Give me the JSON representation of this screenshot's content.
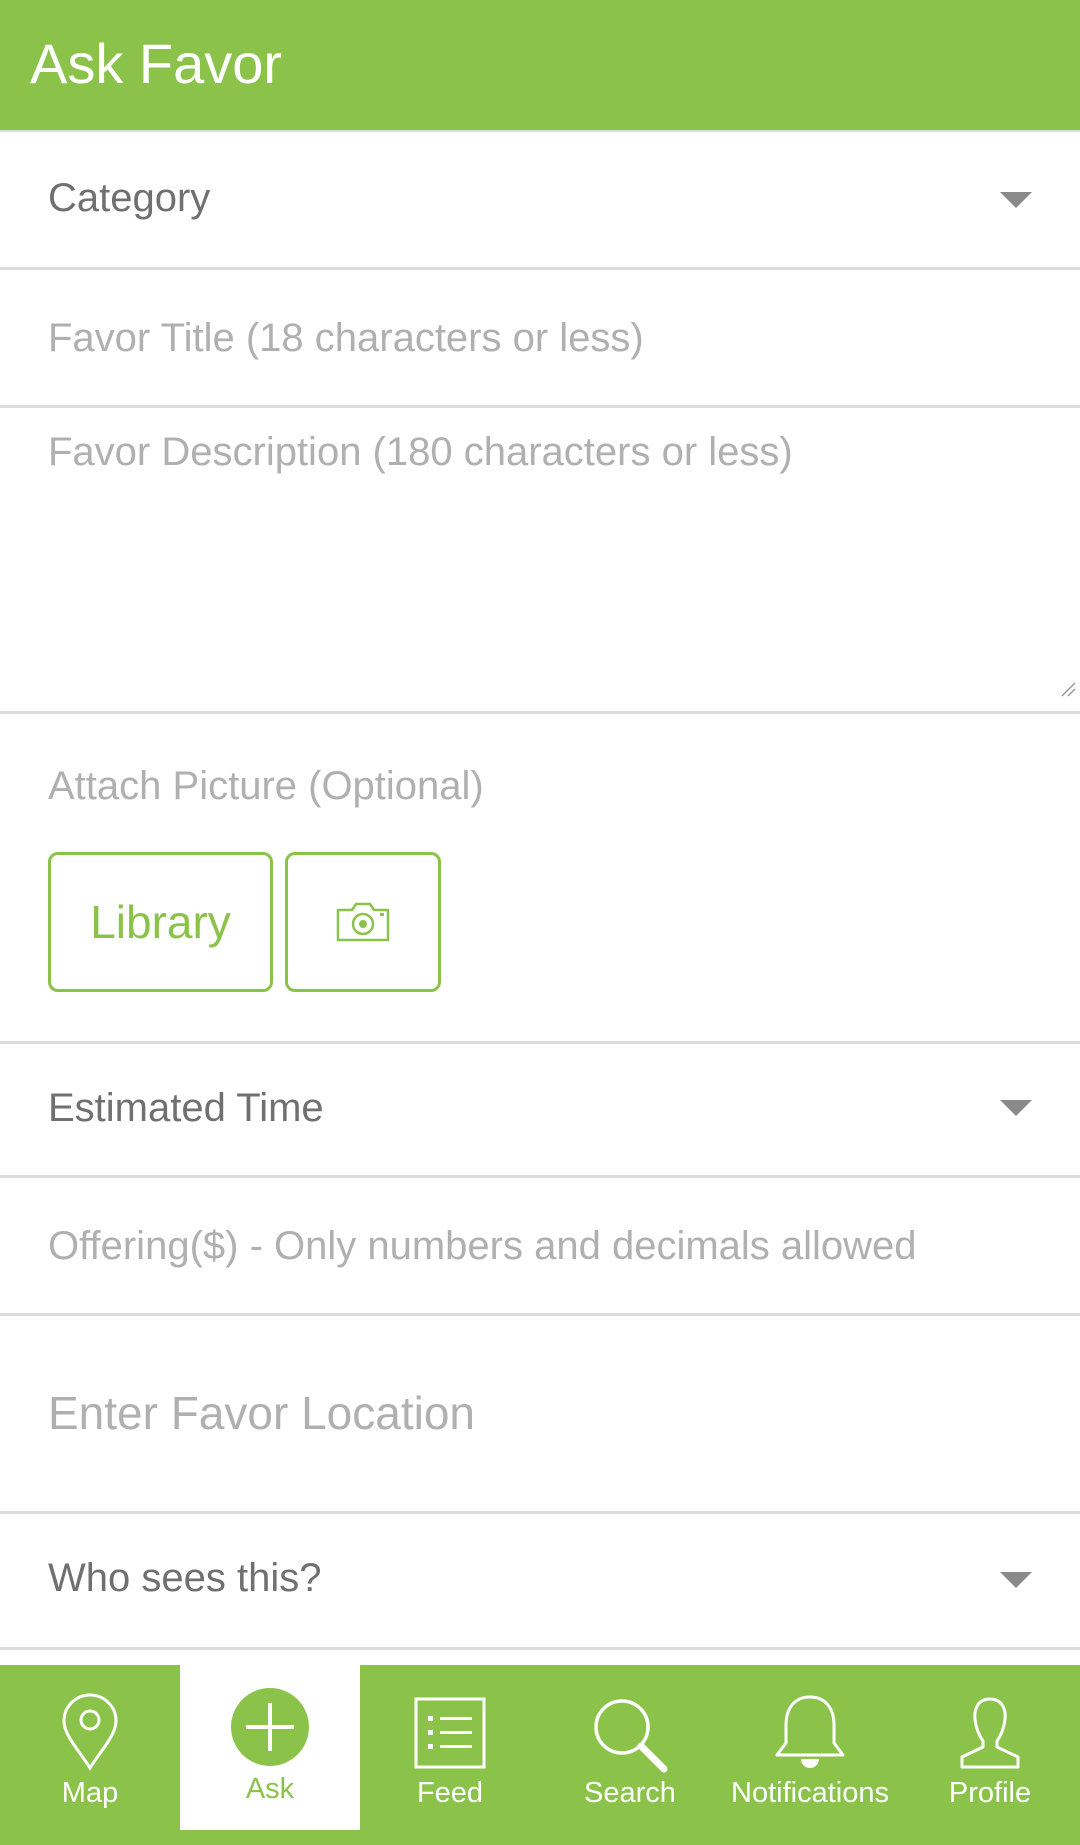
{
  "header": {
    "title": "Ask Favor"
  },
  "form": {
    "category": {
      "label": "Category"
    },
    "favor_title": {
      "placeholder": "Favor Title (18 characters or less)"
    },
    "favor_description": {
      "placeholder": "Favor Description (180 characters or less)"
    },
    "attach": {
      "label": "Attach Picture (Optional)",
      "library_label": "Library",
      "camera_icon": "camera-icon"
    },
    "estimated_time": {
      "label": "Estimated Time"
    },
    "offering": {
      "placeholder": "Offering($) - Only numbers and decimals allowed"
    },
    "location": {
      "placeholder": "Enter Favor Location"
    },
    "visibility": {
      "label": "Who sees this?"
    }
  },
  "tabs": [
    {
      "label": "Map",
      "icon": "map-pin-icon",
      "active": false
    },
    {
      "label": "Ask",
      "icon": "plus-circle-icon",
      "active": true
    },
    {
      "label": "Feed",
      "icon": "list-icon",
      "active": false
    },
    {
      "label": "Search",
      "icon": "search-icon",
      "active": false
    },
    {
      "label": "Notifications",
      "icon": "bell-icon",
      "active": false
    },
    {
      "label": "Profile",
      "icon": "user-icon",
      "active": false
    }
  ],
  "colors": {
    "accent": "#8bc34a",
    "divider": "#dcdcdc",
    "text_dark": "#707070",
    "placeholder": "#b0b0b0"
  }
}
